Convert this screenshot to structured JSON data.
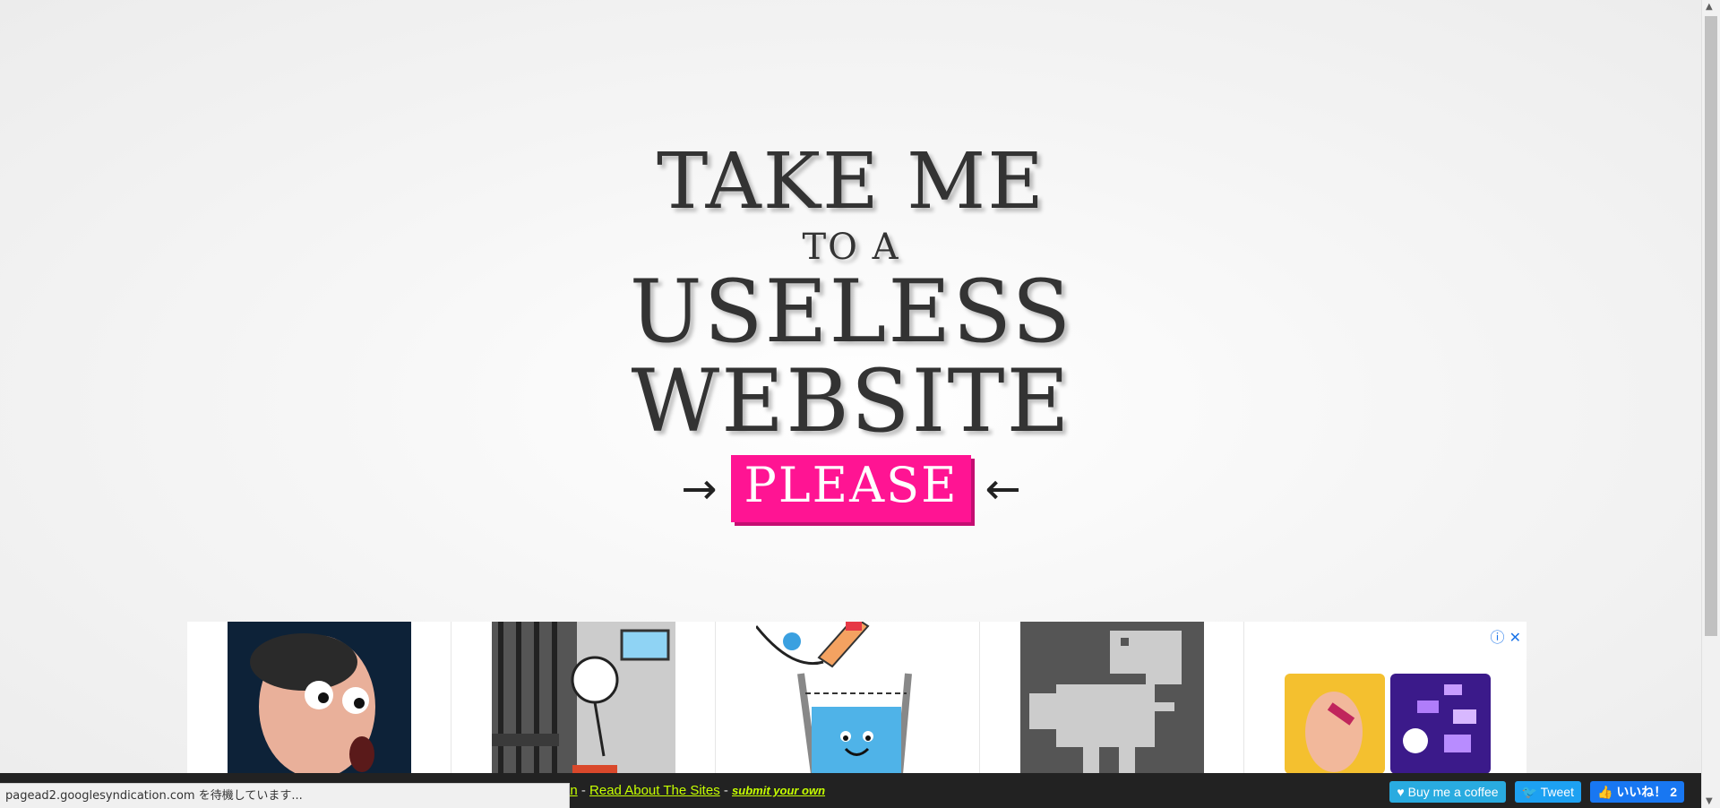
{
  "hero": {
    "line1": "TAKE ME",
    "line2": "TO A",
    "line3": "USELESS",
    "line4": "WEBSITE",
    "cta_label": "PLEASE",
    "arrow_left": "→",
    "arrow_right": "←"
  },
  "ads": {
    "card_icons": [
      "info-icon",
      "close-icon"
    ],
    "info_glyph": "ⓘ",
    "close_glyph": "✕"
  },
  "bottombar": {
    "partial_link": "an",
    "sep1": " - ",
    "link_read": "Read About The Sites",
    "sep2": " - ",
    "link_submit": "submit your own"
  },
  "status": {
    "text": "pagead2.googlesyndication.com を待機しています..."
  },
  "social": {
    "coffee": "Buy me a coffee",
    "tweet": "Tweet",
    "like": "いいね！ 2"
  },
  "colors": {
    "cta_bg": "#ff1493",
    "link_color": "#c6ff00",
    "bar_bg": "#222222"
  }
}
